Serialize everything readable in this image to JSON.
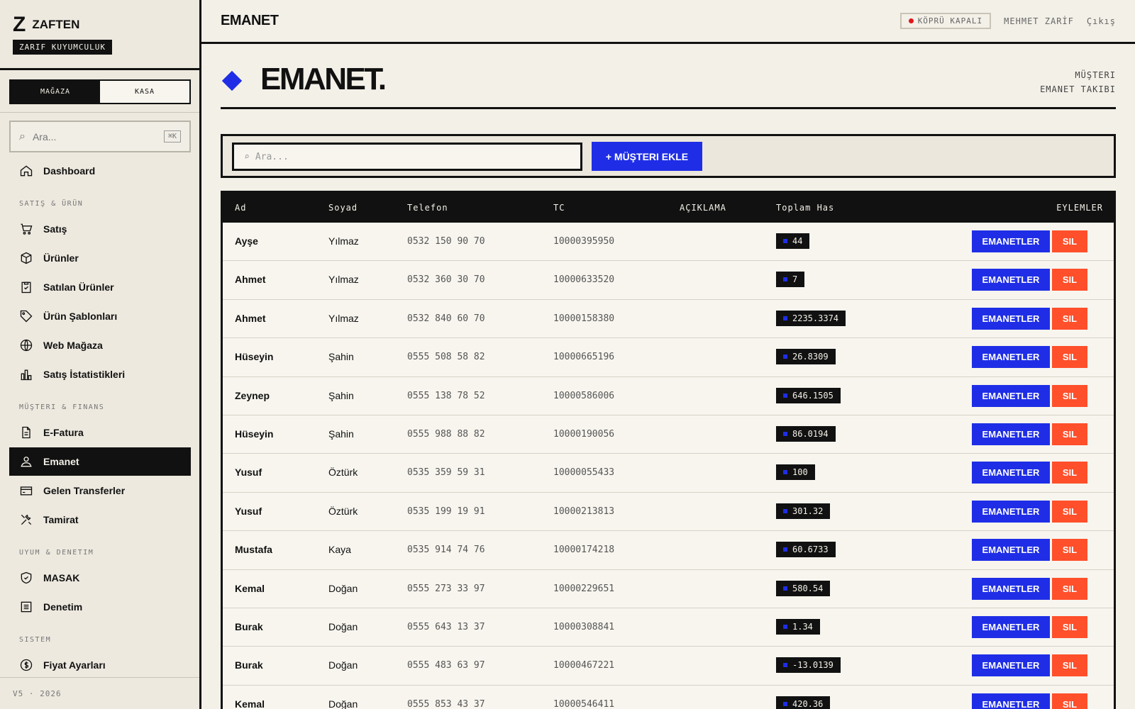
{
  "brand": {
    "logo": "Z",
    "name": "ZAFTEN",
    "sub": "ZARIF KUYUMCULUK"
  },
  "modes": [
    "MAĞAZA",
    "KASA"
  ],
  "sidebar_search": {
    "placeholder": "Ara...",
    "shortcut": "⌘K"
  },
  "nav": {
    "dashboard": "Dashboard",
    "group1": "SATIŞ & ÜRÜN",
    "satis": "Satış",
    "urunler": "Ürünler",
    "satilan": "Satılan Ürünler",
    "sablonlar": "Ürün Şablonları",
    "web": "Web Mağaza",
    "istatistik": "Satış İstatistikleri",
    "group2": "MÜŞTERI & FINANS",
    "efatura": "E-Fatura",
    "emanet": "Emanet",
    "transfer": "Gelen Transferler",
    "tamirat": "Tamirat",
    "group3": "UYUM & DENETIM",
    "masak": "MASAK",
    "denetim": "Denetim",
    "group4": "SISTEM",
    "fiyat": "Fiyat Ayarları"
  },
  "footer": "V5 · 2026",
  "topbar": {
    "title": "EMANET",
    "bridge": "KÖPRÜ KAPALI",
    "user": "MEHMET ZARİF",
    "logout": "Çıkış"
  },
  "page": {
    "title": "EMANET.",
    "crumb1": "MÜŞTERI",
    "crumb2": "EMANET TAKIBI"
  },
  "toolbar": {
    "search_placeholder": "Ara...",
    "add_label": "+ MÜŞTERI EKLE"
  },
  "table": {
    "headers": {
      "ad": "Ad",
      "soyad": "Soyad",
      "telefon": "Telefon",
      "tc": "TC",
      "aciklama": "AÇIKLAMA",
      "has": "Toplam Has",
      "eylemler": "EYLEMLER"
    },
    "btn_emanet": "EMANETLER",
    "btn_sil": "SIL",
    "rows": [
      {
        "ad": "Ayşe",
        "soyad": "Yılmaz",
        "tel": "0532 150 90 70",
        "tc": "10000395950",
        "has": "44"
      },
      {
        "ad": "Ahmet",
        "soyad": "Yılmaz",
        "tel": "0532 360 30 70",
        "tc": "10000633520",
        "has": "7"
      },
      {
        "ad": "Ahmet",
        "soyad": "Yılmaz",
        "tel": "0532 840 60 70",
        "tc": "10000158380",
        "has": "2235.3374"
      },
      {
        "ad": "Hüseyin",
        "soyad": "Şahin",
        "tel": "0555 508 58 82",
        "tc": "10000665196",
        "has": "26.8309"
      },
      {
        "ad": "Zeynep",
        "soyad": "Şahin",
        "tel": "0555 138 78 52",
        "tc": "10000586006",
        "has": "646.1505"
      },
      {
        "ad": "Hüseyin",
        "soyad": "Şahin",
        "tel": "0555 988 88 82",
        "tc": "10000190056",
        "has": "86.0194"
      },
      {
        "ad": "Yusuf",
        "soyad": "Öztürk",
        "tel": "0535 359 59 31",
        "tc": "10000055433",
        "has": "100"
      },
      {
        "ad": "Yusuf",
        "soyad": "Öztürk",
        "tel": "0535 199 19 91",
        "tc": "10000213813",
        "has": "301.32"
      },
      {
        "ad": "Mustafa",
        "soyad": "Kaya",
        "tel": "0535 914 74 76",
        "tc": "10000174218",
        "has": "60.6733"
      },
      {
        "ad": "Kemal",
        "soyad": "Doğan",
        "tel": "0555 273 33 97",
        "tc": "10000229651",
        "has": "580.54"
      },
      {
        "ad": "Burak",
        "soyad": "Doğan",
        "tel": "0555 643 13 37",
        "tc": "10000308841",
        "has": "1.34"
      },
      {
        "ad": "Burak",
        "soyad": "Doğan",
        "tel": "0555 483 63 97",
        "tc": "10000467221",
        "has": "-13.0139"
      },
      {
        "ad": "Kemal",
        "soyad": "Doğan",
        "tel": "0555 853 43 37",
        "tc": "10000546411",
        "has": "420.36"
      }
    ]
  },
  "colors": {
    "accent": "#1f2ee6",
    "danger": "#ff4f2b",
    "ink": "#111111",
    "paper": "#f3f0e8"
  }
}
